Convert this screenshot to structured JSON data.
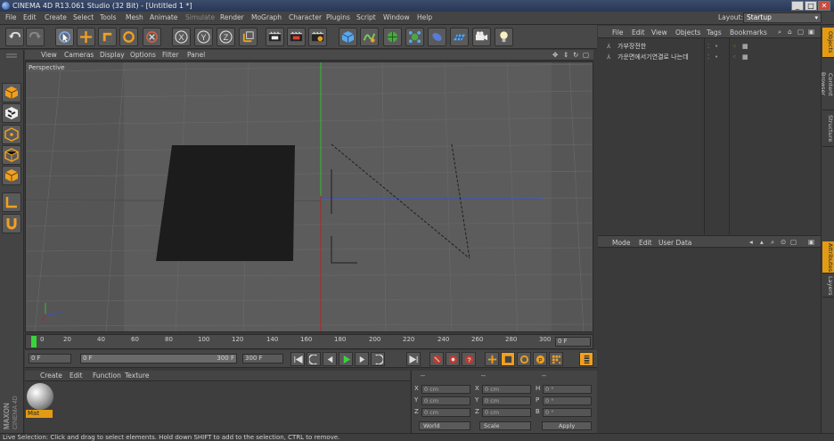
{
  "window": {
    "title": "CINEMA 4D R13.061 Studio (32 Bit) - [Untitled 1 *]",
    "controls": [
      "_",
      "□",
      "✕"
    ]
  },
  "menubar": {
    "items": [
      {
        "label": "File",
        "enabled": true
      },
      {
        "label": "Edit",
        "enabled": true
      },
      {
        "label": "Create",
        "enabled": true
      },
      {
        "label": "Select",
        "enabled": true
      },
      {
        "label": "Tools",
        "enabled": true
      },
      {
        "label": "Mesh",
        "enabled": true
      },
      {
        "label": "Animate",
        "enabled": true
      },
      {
        "label": "Simulate",
        "enabled": false
      },
      {
        "label": "Render",
        "enabled": true
      },
      {
        "label": "MoGraph",
        "enabled": true
      },
      {
        "label": "Character",
        "enabled": true
      },
      {
        "label": "Plugins",
        "enabled": true
      },
      {
        "label": "Script",
        "enabled": true
      },
      {
        "label": "Window",
        "enabled": true
      },
      {
        "label": "Help",
        "enabled": true
      }
    ],
    "layout_label": "Layout:",
    "layout_value": "Startup"
  },
  "toolbar": {
    "icons": [
      "undo-icon",
      "redo-icon",
      "live-select-icon",
      "move-icon",
      "scale-icon",
      "rotate-icon",
      "last-tool-icon",
      "x-axis-icon",
      "y-axis-icon",
      "z-axis-icon",
      "coordinate-system-icon",
      "render-view-icon",
      "render-picture-viewer-icon",
      "edit-render-settings-icon",
      "cube-icon",
      "spline-pen-icon",
      "subdivision-surface-icon",
      "array-icon",
      "deformer-icon",
      "floor-icon",
      "camera-icon",
      "light-icon"
    ],
    "axis_labels": [
      "X",
      "Y",
      "Z"
    ]
  },
  "leftbar": {
    "icons": [
      "make-editable-icon",
      "checkerboard-icon",
      "points-mode-icon",
      "edges-mode-icon",
      "polygons-mode-icon",
      "workplane-icon",
      "snap-icon"
    ]
  },
  "viewport": {
    "menu": [
      "View",
      "Cameras",
      "Display",
      "Options",
      "Filter",
      "Panel"
    ],
    "label": "Perspective"
  },
  "timeline": {
    "ticks": [
      "0",
      "20",
      "40",
      "60",
      "80",
      "100",
      "120",
      "140",
      "160",
      "180",
      "200",
      "220",
      "240",
      "260",
      "280",
      "300"
    ],
    "current_frame": "0 F"
  },
  "transport": {
    "start_field": "0 F",
    "min_field": "0 F",
    "max_field": "300 F",
    "end_field": "300 F"
  },
  "material_manager": {
    "menu": [
      "Create",
      "Edit",
      "Function",
      "Texture"
    ],
    "materials": [
      {
        "name": "Mat"
      }
    ]
  },
  "coordinates": {
    "col_headers": [
      "--",
      "--",
      "--"
    ],
    "rows": [
      {
        "axis": "X",
        "pos": "0 cm",
        "size_label": "X",
        "size": "0 cm",
        "rot_label": "H",
        "rot": "0 °"
      },
      {
        "axis": "Y",
        "pos": "0 cm",
        "size_label": "Y",
        "size": "0 cm",
        "rot_label": "P",
        "rot": "0 °"
      },
      {
        "axis": "Z",
        "pos": "0 cm",
        "size_label": "Z",
        "size": "0 cm",
        "rot_label": "B",
        "rot": "0 °"
      }
    ],
    "mode_world": "World",
    "mode_scale": "Scale",
    "apply_label": "Apply"
  },
  "object_manager": {
    "menu": [
      "File",
      "Edit",
      "View",
      "Objects",
      "Tags",
      "Bookmarks"
    ],
    "objects": [
      {
        "name": "가부장전한"
      },
      {
        "name": "가운면에서기연결로 나는데"
      }
    ]
  },
  "attribute_manager": {
    "menu": [
      "Mode",
      "Edit",
      "User Data"
    ]
  },
  "right_tabs": {
    "tabs": [
      {
        "label": "Objects",
        "active": true
      },
      {
        "label": "Content Browser",
        "active": false
      },
      {
        "label": "Structure",
        "active": false
      },
      {
        "label": "Attributes",
        "active": true
      },
      {
        "label": "Layers",
        "active": false
      }
    ]
  },
  "status": {
    "text": "Live Selection: Click and drag to select elements. Hold down SHIFT to add to the selection, CTRL to remove."
  },
  "branding": {
    "vendor": "MAXON",
    "product": "CINEMA 4D"
  }
}
